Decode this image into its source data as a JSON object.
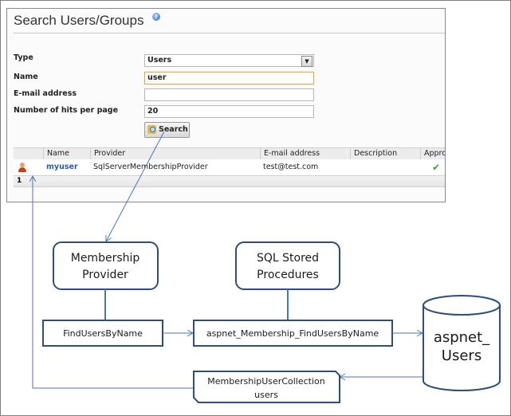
{
  "panel": {
    "title": "Search Users/Groups",
    "help_icon": "help-icon",
    "form": {
      "type_label": "Type",
      "type_value": "Users",
      "name_label": "Name",
      "name_value": "user",
      "email_label": "E-mail address",
      "email_value": "",
      "hits_label": "Number of hits per page",
      "hits_value": "20",
      "search_button": "Search"
    },
    "grid": {
      "columns": [
        "",
        "Name",
        "Provider",
        "E-mail address",
        "Description",
        "Appro"
      ],
      "rows": [
        {
          "icon": "user-icon",
          "name": "myuser",
          "provider": "SqlServerMembershipProvider",
          "email": "test@test.com",
          "description": "",
          "approved": "check-icon"
        }
      ],
      "pager": "1"
    }
  },
  "diagram": {
    "membership_provider": [
      "Membership",
      "Provider"
    ],
    "sql_stored_procedures": [
      "SQL Stored",
      "Procedures"
    ],
    "find_users_by_name": "FindUsersByName",
    "stored_procedure": "aspnet_Membership_FindUsersByName",
    "database": [
      "aspnet_",
      "Users"
    ],
    "result": [
      "MembershipUserCollection",
      "users"
    ],
    "line_color": "#4a76ae",
    "box_border_color": "#2f4e77"
  }
}
